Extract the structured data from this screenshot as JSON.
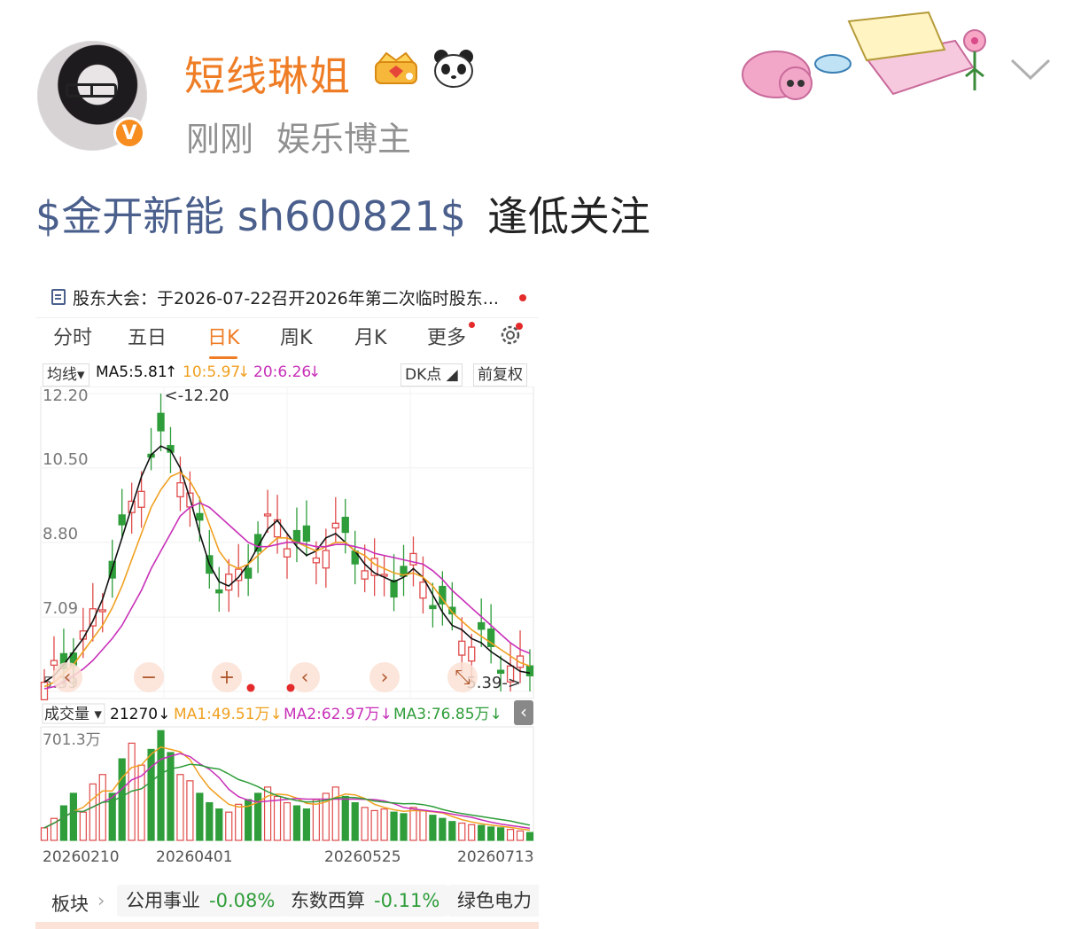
{
  "header": {
    "username": "短线琳姐",
    "time": "刚刚",
    "role": "娱乐博主",
    "verified_badge": "V"
  },
  "post": {
    "stock_tag": "$金开新能 sh600821$",
    "text": "逢低关注"
  },
  "stock_card": {
    "notice": "股东大会：于2026-07-22召开2026年第二次临时股东...",
    "tabs": [
      "分时",
      "五日",
      "日K",
      "周K",
      "月K",
      "更多"
    ],
    "active_tab": "日K",
    "ma_row": {
      "selector": "均线",
      "ma5": "MA5:5.81",
      "ma10": "10:5.97",
      "ma20": "20:6.26",
      "dk_button": "DK点",
      "adjust_button": "前复权"
    },
    "volume_row": {
      "selector": "成交量",
      "current": "21270",
      "ma1": "MA1:49.51万",
      "ma2": "MA2:62.97万",
      "ma3": "MA3:76.85万",
      "max_label": "701.3万"
    },
    "high_label": "<-12.20",
    "low_label": "5.39->",
    "sector": {
      "label": "板块",
      "items": [
        {
          "name": "公用事业",
          "change": "-0.08%"
        },
        {
          "name": "东数西算",
          "change": "-0.11%"
        },
        {
          "name": "绿色电力",
          "change": ""
        }
      ]
    },
    "colors": {
      "up": "#e04a4a",
      "down": "#2e9d3a",
      "ma5": "#111111",
      "ma10": "#f0a020",
      "ma20": "#c830b8",
      "accent": "#ef7d26"
    }
  },
  "chart_data": [
    {
      "type": "candlestick",
      "title": "",
      "ylabel": "",
      "y_ticks": [
        "12.20",
        "10.50",
        "8.80",
        "7.09",
        "5.39"
      ],
      "ylim": [
        5.39,
        12.2
      ],
      "x_ticks": [
        "20260210",
        "20260401",
        "20260525",
        "20260713"
      ],
      "series": [
        {
          "name": "MA5:5.81",
          "values": [
            5.6,
            5.75,
            6.0,
            6.3,
            6.6,
            7.0,
            7.5,
            8.2,
            8.9,
            9.6,
            10.3,
            10.8,
            11.0,
            10.9,
            10.5,
            9.8,
            9.0,
            8.3,
            7.9,
            7.8,
            8.0,
            8.3,
            8.7,
            9.1,
            9.3,
            9.0,
            8.7,
            8.5,
            8.6,
            8.9,
            9.0,
            8.8,
            8.6,
            8.3,
            8.1,
            8.0,
            7.9,
            8.0,
            8.2,
            8.0,
            7.6,
            7.2,
            6.9,
            6.8,
            6.6,
            6.5,
            6.3,
            6.15,
            6.0,
            5.85,
            5.81
          ]
        },
        {
          "name": "10:5.97",
          "values": [
            5.5,
            5.6,
            5.8,
            6.0,
            6.3,
            6.6,
            6.9,
            7.3,
            7.8,
            8.4,
            9.0,
            9.6,
            10.0,
            10.3,
            10.4,
            10.2,
            9.8,
            9.2,
            8.6,
            8.3,
            8.2,
            8.3,
            8.5,
            8.7,
            8.9,
            8.9,
            8.8,
            8.7,
            8.6,
            8.7,
            8.8,
            8.8,
            8.6,
            8.5,
            8.3,
            8.2,
            8.1,
            8.05,
            8.1,
            8.0,
            7.8,
            7.5,
            7.2,
            7.0,
            6.8,
            6.65,
            6.5,
            6.35,
            6.2,
            6.05,
            5.97
          ]
        },
        {
          "name": "20:6.26",
          "values": [
            5.45,
            5.5,
            5.6,
            5.75,
            5.9,
            6.1,
            6.35,
            6.6,
            6.9,
            7.3,
            7.7,
            8.2,
            8.6,
            9.0,
            9.4,
            9.6,
            9.7,
            9.6,
            9.4,
            9.2,
            9.0,
            8.8,
            8.7,
            8.7,
            8.75,
            8.8,
            8.8,
            8.75,
            8.7,
            8.7,
            8.75,
            8.75,
            8.7,
            8.65,
            8.55,
            8.5,
            8.45,
            8.4,
            8.35,
            8.3,
            8.15,
            7.95,
            7.7,
            7.5,
            7.3,
            7.1,
            6.9,
            6.7,
            6.5,
            6.35,
            6.26
          ]
        }
      ]
    },
    {
      "type": "bar",
      "title": "",
      "ylabel": "",
      "y_ticks": [
        "701.3万"
      ],
      "ylim": [
        0,
        701.3
      ],
      "units": "万",
      "x_ticks": [
        "20260210",
        "20260401",
        "20260525",
        "20260713"
      ],
      "values": [
        80,
        140,
        220,
        300,
        180,
        360,
        420,
        300,
        520,
        620,
        480,
        580,
        700,
        560,
        420,
        380,
        300,
        240,
        200,
        180,
        230,
        260,
        300,
        340,
        280,
        240,
        220,
        200,
        260,
        300,
        340,
        280,
        240,
        210,
        190,
        200,
        180,
        170,
        210,
        190,
        160,
        140,
        120,
        110,
        100,
        95,
        85,
        80,
        70,
        60,
        50
      ]
    }
  ]
}
